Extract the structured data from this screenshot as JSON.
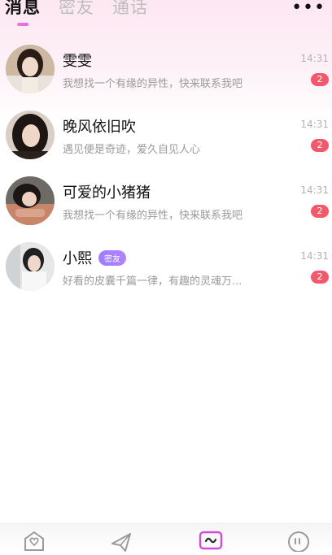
{
  "tabs": [
    {
      "label": "消息",
      "active": true
    },
    {
      "label": "密友",
      "active": false
    },
    {
      "label": "通话",
      "active": false
    }
  ],
  "more_icon": "more-icon",
  "conversations": [
    {
      "name": "雯雯",
      "message": "我想找一个有缘的异性，快来联系我吧",
      "time": "14:31",
      "unread": "2",
      "tag": ""
    },
    {
      "name": "晚风依旧吹",
      "message": "遇见便是奇迹，爱久自见人心",
      "time": "14:31",
      "unread": "2",
      "tag": ""
    },
    {
      "name": "可爱的小猪猪",
      "message": "我想找一个有缘的异性，快来联系我吧",
      "time": "14:31",
      "unread": "2",
      "tag": ""
    },
    {
      "name": "小熙",
      "message": "好看的皮囊千篇一律，有趣的灵魂万...",
      "time": "14:31",
      "unread": "2",
      "tag": "密友"
    }
  ],
  "bottom_nav": [
    {
      "icon": "heart-home-icon",
      "active": false
    },
    {
      "icon": "send-icon",
      "active": false
    },
    {
      "icon": "chat-wave-icon",
      "active": true
    },
    {
      "icon": "quote-bubble-icon",
      "active": false
    }
  ],
  "colors": {
    "accent_pink": "#ff7ab8",
    "accent_purple": "#c86bff",
    "unread_badge": "#f25a6b",
    "tag_purple": "#9d7cff"
  }
}
